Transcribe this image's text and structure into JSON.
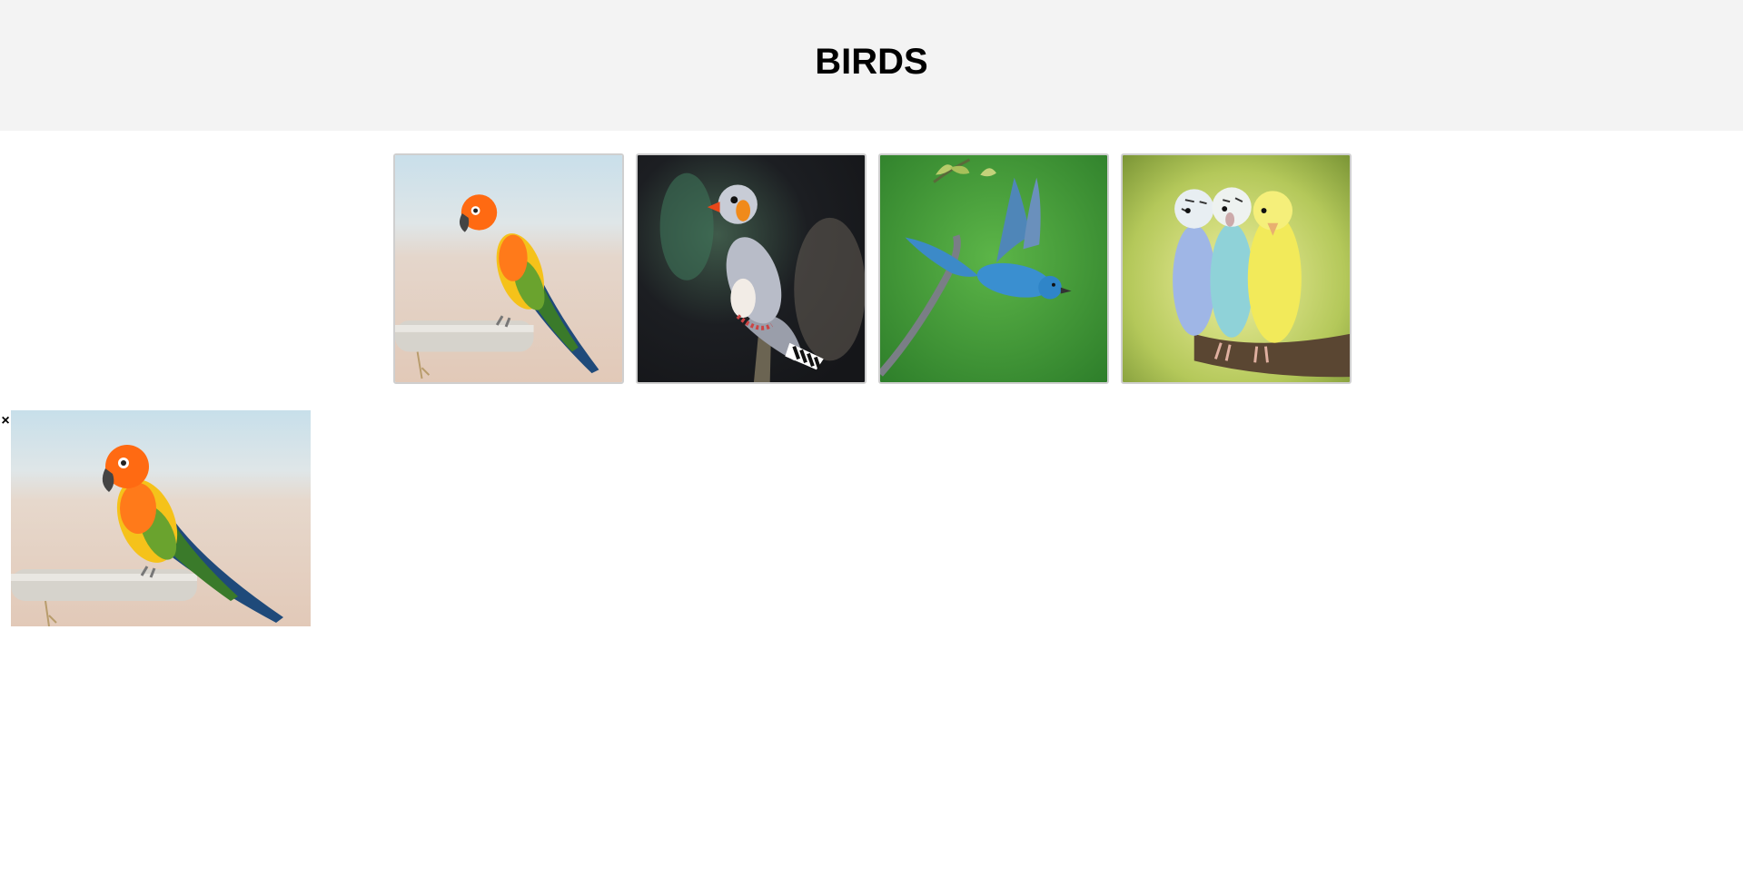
{
  "header": {
    "title": "BIRDS"
  },
  "gallery": [
    {
      "name": "sun-conure-parrot-image"
    },
    {
      "name": "zebra-finch-image"
    },
    {
      "name": "blue-bird-flying-image"
    },
    {
      "name": "budgie-trio-image"
    }
  ],
  "preview": {
    "close_glyph": "×",
    "image": "sun-conure-parrot-image"
  }
}
